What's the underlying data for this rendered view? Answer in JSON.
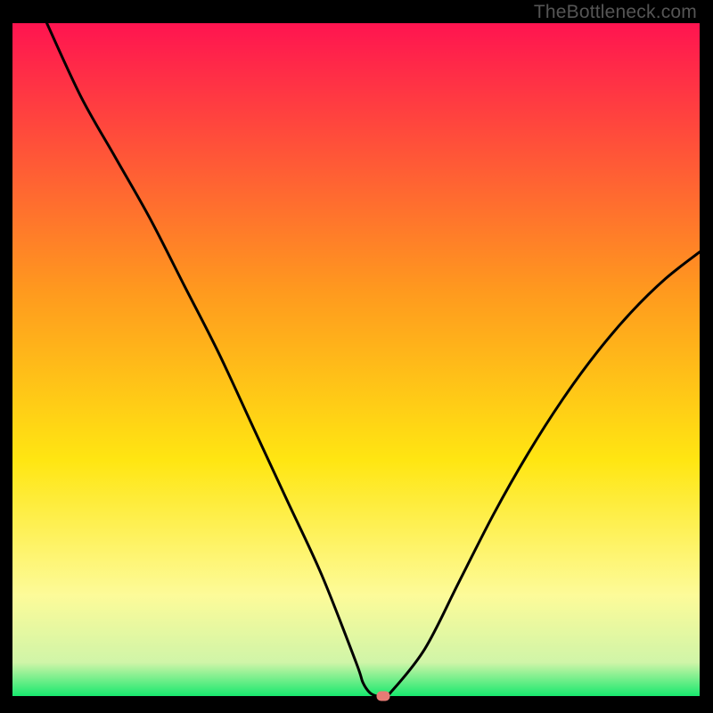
{
  "watermark": "TheBottleneck.com",
  "chart_data": {
    "type": "line",
    "title": "",
    "xlabel": "",
    "ylabel": "",
    "xlim": [
      0,
      100
    ],
    "ylim": [
      0,
      100
    ],
    "series": [
      {
        "name": "curve",
        "x": [
          5,
          10,
          15,
          20,
          25,
          30,
          35,
          40,
          45,
          50,
          51,
          52,
          53,
          54,
          55,
          60,
          65,
          70,
          75,
          80,
          85,
          90,
          95,
          100
        ],
        "y": [
          100,
          89,
          80,
          71,
          61,
          51,
          40,
          29,
          18,
          5,
          2,
          0.5,
          0,
          0,
          0.5,
          7,
          17,
          27,
          36,
          44,
          51,
          57,
          62,
          66
        ]
      }
    ],
    "marker": {
      "x": 54,
      "y": 0
    },
    "gradient_stops": [
      {
        "offset": 0,
        "color": "#ff1450"
      },
      {
        "offset": 40,
        "color": "#ff9a1e"
      },
      {
        "offset": 65,
        "color": "#ffe612"
      },
      {
        "offset": 85,
        "color": "#fdfb99"
      },
      {
        "offset": 95,
        "color": "#d0f5a8"
      },
      {
        "offset": 100,
        "color": "#18e86e"
      }
    ]
  }
}
